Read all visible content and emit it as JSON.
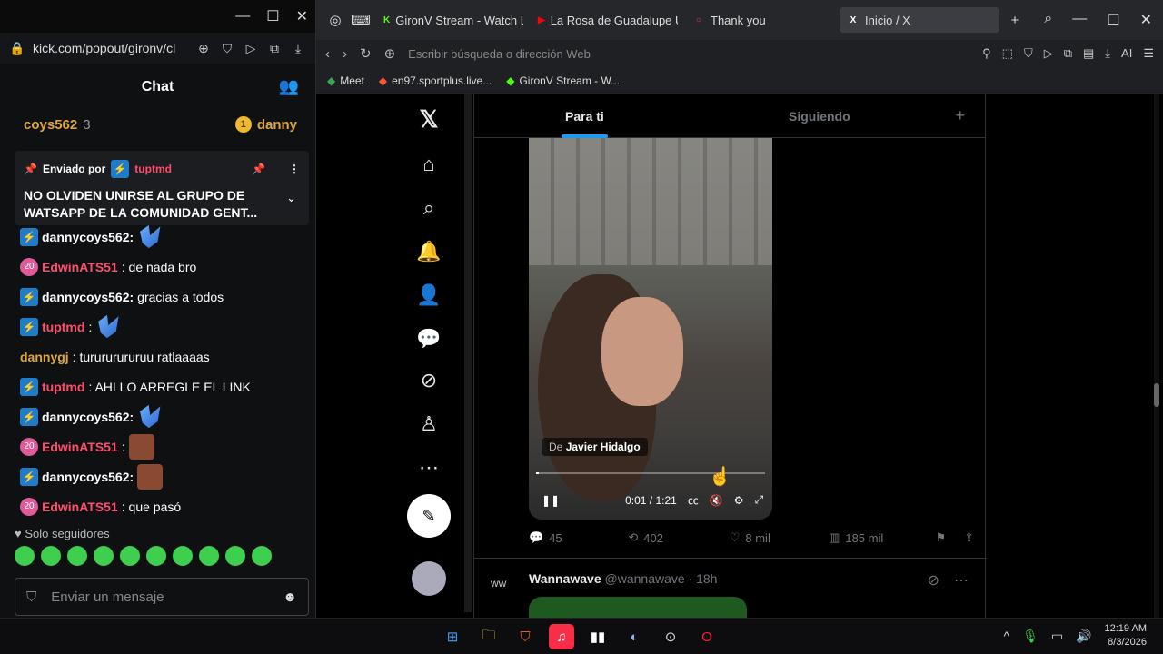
{
  "kick": {
    "url": "kick.com/popout/gironv/cl",
    "chat_title": "Chat",
    "gift_user": "coys562",
    "gift_count": "3",
    "gift_user2": "danny",
    "pinned": {
      "sent_by": "Enviado por",
      "user": "tuptmd",
      "message": "NO OLVIDEN UNIRSE AL GRUPO DE WATSAPP DE LA COMUNIDAD GENT..."
    },
    "messages": [
      {
        "user": "dannycoys562:",
        "text": "",
        "color": "white",
        "badge": "k",
        "emote": "butter"
      },
      {
        "user": "EdwinATS51",
        "text": ": de nada bro",
        "color": "pink",
        "badge": "20",
        "emote": ""
      },
      {
        "user": "dannycoys562:",
        "text": "gracias a todos",
        "color": "white",
        "badge": "k",
        "emote": ""
      },
      {
        "user": "tuptmd",
        "text": ":",
        "color": "pink",
        "badge": "k",
        "emote": "butter"
      },
      {
        "user": "dannygj",
        "text": ": turururururuu ratlaaaas",
        "color": "gold",
        "badge": "",
        "emote": ""
      },
      {
        "user": "tuptmd",
        "text": ": AHI LO ARREGLE EL LINK",
        "color": "pink",
        "badge": "k",
        "emote": ""
      },
      {
        "user": "dannycoys562:",
        "text": "",
        "color": "white",
        "badge": "k",
        "emote": "butter"
      },
      {
        "user": "EdwinATS51",
        "text": ":",
        "color": "pink",
        "badge": "20",
        "emote": "face"
      },
      {
        "user": "dannycoys562:",
        "text": "",
        "color": "white",
        "badge": "k",
        "emote": "face"
      },
      {
        "user": "EdwinATS51",
        "text": ": que pasó",
        "color": "pink",
        "badge": "20",
        "emote": ""
      }
    ],
    "followers_only": "Solo seguidores",
    "input_placeholder": "Enviar un mensaje"
  },
  "browser": {
    "tabs": [
      {
        "label": "GironV Stream - Watch Li",
        "fav": "K",
        "fav_color": "#53fc18"
      },
      {
        "label": "La Rosa de Guadalupe U",
        "fav": "▶",
        "fav_color": "#ff0000"
      },
      {
        "label": "Thank you",
        "fav": "○",
        "fav_color": "#ff3355"
      },
      {
        "label": "Inicio / X",
        "fav": "X",
        "fav_color": "#ffffff"
      }
    ],
    "address_placeholder": "Escribir búsqueda o dirección Web",
    "ai_label": "AI",
    "bookmarks": [
      {
        "label": "Meet"
      },
      {
        "label": "en97.sportplus.live..."
      },
      {
        "label": "GironV Stream - W..."
      }
    ]
  },
  "x": {
    "tab_for_you": "Para ti",
    "tab_following": "Siguiendo",
    "video": {
      "from": "De",
      "author": "Javier Hidalgo",
      "time": "0:01 / 1:21",
      "progress": 0.01
    },
    "stats": {
      "replies": "45",
      "reposts": "402",
      "likes": "8 mil",
      "views": "185 mil"
    },
    "next_tweet": {
      "name": "Wannawave",
      "handle": "@wannawave · 18h"
    }
  },
  "taskbar": {
    "time": "12:19 AM",
    "date": "8/3/2026"
  }
}
